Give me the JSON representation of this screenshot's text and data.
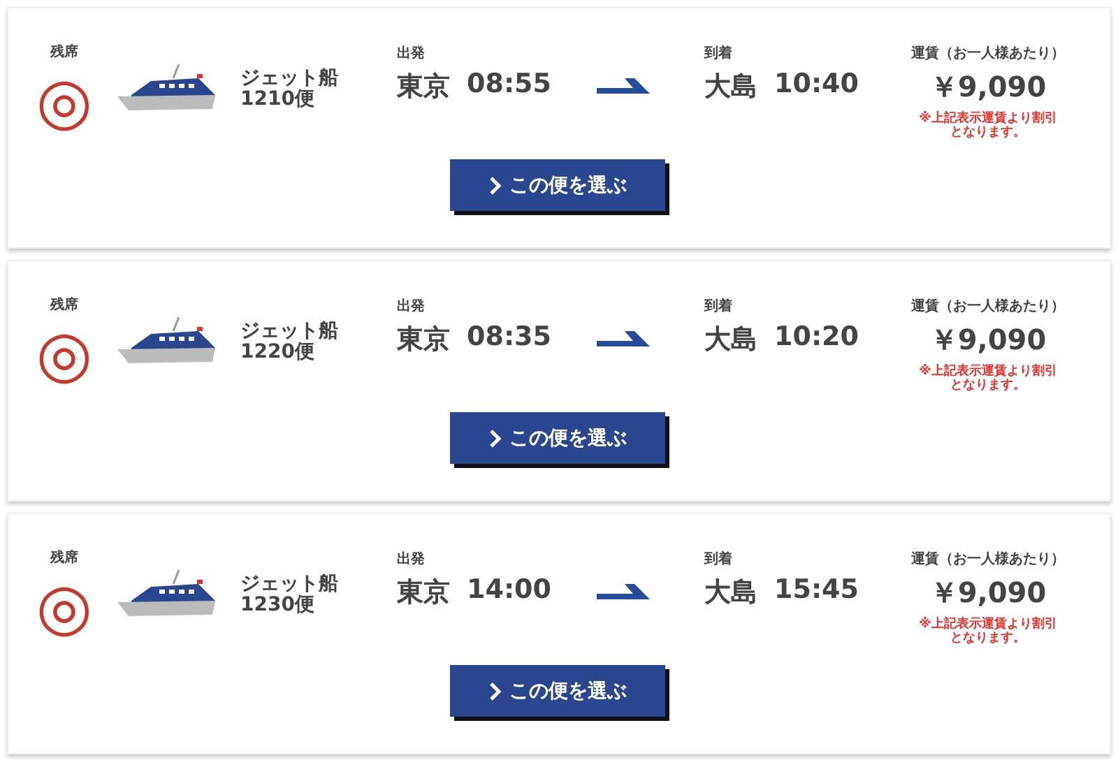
{
  "voyages": [
    {
      "seat_label": "残席",
      "seats": "◎",
      "vessel": "ジェット船",
      "flight": "1210便",
      "depart_label": "出発",
      "depart_port": "東京",
      "depart_time": "08:55",
      "arrive_label": "到着",
      "arrive_port": "大島",
      "arrive_time": "10:40",
      "fare_label": "運賃（お一人様あたり）",
      "fare": "￥9,090",
      "fare_note": "※上記表示運賃より割引となります。",
      "button": "この便を選ぶ"
    },
    {
      "seat_label": "残席",
      "seats": "◎",
      "vessel": "ジェット船",
      "flight": "1220便",
      "depart_label": "出発",
      "depart_port": "東京",
      "depart_time": "08:35",
      "arrive_label": "到着",
      "arrive_port": "大島",
      "arrive_time": "10:20",
      "fare_label": "運賃（お一人様あたり）",
      "fare": "￥9,090",
      "fare_note": "※上記表示運賃より割引となります。",
      "button": "この便を選ぶ"
    },
    {
      "seat_label": "残席",
      "seats": "◎",
      "vessel": "ジェット船",
      "flight": "1230便",
      "depart_label": "出発",
      "depart_port": "東京",
      "depart_time": "14:00",
      "arrive_label": "到着",
      "arrive_port": "大島",
      "arrive_time": "15:45",
      "fare_label": "運賃（お一人様あたり）",
      "fare": "￥9,090",
      "fare_note": "※上記表示運賃より割引となります。",
      "button": "この便を選ぶ"
    }
  ]
}
